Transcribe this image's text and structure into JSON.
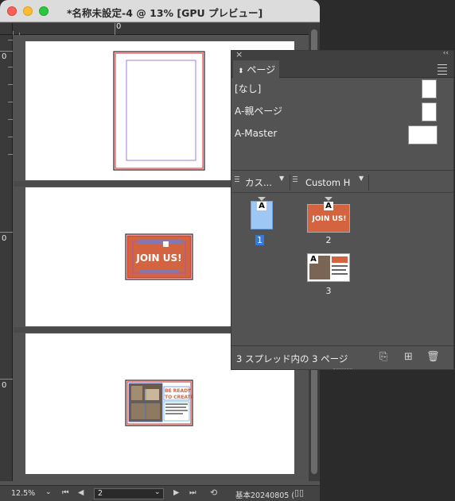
{
  "window": {
    "title": "*名称未設定-4 @ 13% [GPU プレビュー]"
  },
  "rulers": {
    "h_zero": "0",
    "v_labels": [
      "0",
      "0",
      "0"
    ]
  },
  "document_pages": [
    {
      "type": "blank-frame"
    },
    {
      "type": "poster",
      "text": "JOIN US!"
    },
    {
      "type": "flyer",
      "text_a": "BE READY",
      "text_b": "TO CREATE"
    }
  ],
  "statusbar": {
    "zoom": "12.5%",
    "page_value": "2",
    "preflight_profile": "基本20240805 (",
    "nav_first": "⏮",
    "nav_prev": "◀",
    "nav_next": "▶",
    "nav_last": "⏭"
  },
  "pages_panel": {
    "tab_label": "ページ",
    "tab_icon": "up-down-arrows-icon",
    "masters": [
      {
        "label": "[なし]"
      },
      {
        "label": "A-親ページ"
      },
      {
        "label": "A-Master"
      }
    ],
    "size_selector_left": "カス...",
    "size_selector_right": "Custom H",
    "pages": [
      {
        "number": "1",
        "master": "A",
        "selected": true
      },
      {
        "number": "2",
        "master": "A",
        "selected": false,
        "thumb_text": "JOIN US!"
      },
      {
        "number": "3",
        "master": "A",
        "selected": false
      }
    ],
    "footer_text": "3 スプレッド内の 3 ページ",
    "accent_color": "#2f7ae5",
    "poster_color": "#d4643f"
  }
}
